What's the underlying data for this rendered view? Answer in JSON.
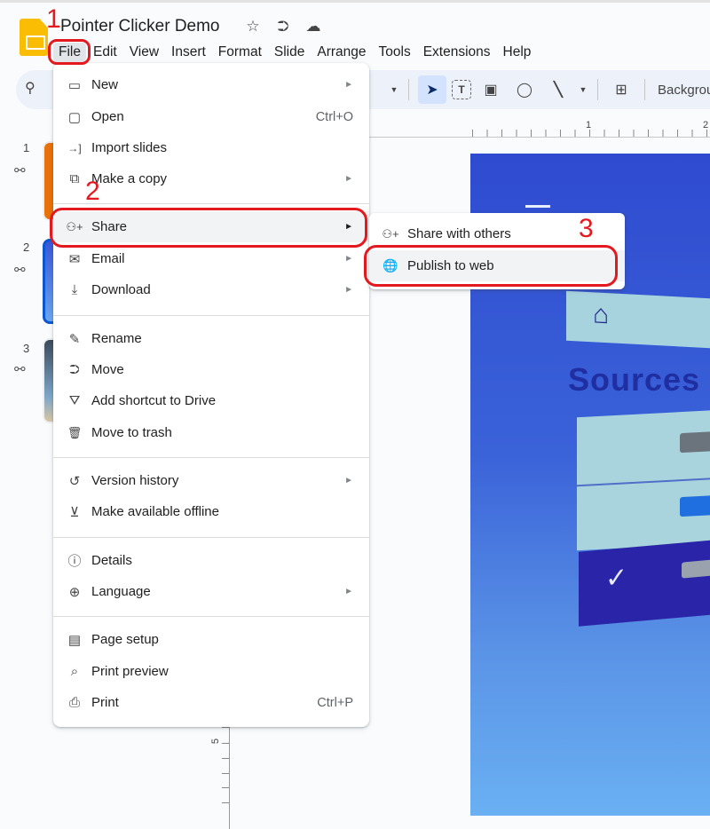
{
  "app": {
    "title": "Pointer Clicker Demo",
    "title_icons": [
      {
        "name": "star-icon",
        "glyph": "☆"
      },
      {
        "name": "move-to-folder-icon",
        "glyph": "⮊"
      },
      {
        "name": "cloud-saved-icon",
        "glyph": "☁"
      }
    ],
    "brand_color": "#fbbc04"
  },
  "menubar": {
    "items": [
      "File",
      "Edit",
      "View",
      "Insert",
      "Format",
      "Slide",
      "Arrange",
      "Tools",
      "Extensions",
      "Help"
    ],
    "active": "File"
  },
  "toolbar": {
    "search_icon": "⚲",
    "tools": [
      {
        "name": "select-icon",
        "glyph": "➤",
        "selected": true
      },
      {
        "name": "text-box-icon",
        "glyph": "T"
      },
      {
        "name": "image-icon",
        "glyph": "▣"
      },
      {
        "name": "shape-icon",
        "glyph": "◯"
      },
      {
        "name": "line-icon",
        "glyph": "╲"
      }
    ],
    "comment_icon": "⊞",
    "background_label": "Backgrour"
  },
  "ruler": {
    "h_labels": [
      "1",
      "2"
    ],
    "v_labels": [
      "5"
    ]
  },
  "filmstrip": {
    "slides": [
      {
        "number": "1",
        "link_icon": "⚯"
      },
      {
        "number": "2",
        "link_icon": "⚯",
        "selected": true
      },
      {
        "number": "3",
        "link_icon": "⚯"
      }
    ]
  },
  "slide_content": {
    "heading": "Sources",
    "check_glyph": "✓",
    "home_glyph": "⌂"
  },
  "file_menu": {
    "groups": [
      [
        {
          "label": "New",
          "icon": "new-slides-icon",
          "glyph": "▭",
          "submenu": true
        },
        {
          "label": "Open",
          "icon": "folder-icon",
          "glyph": "▢",
          "shortcut": "Ctrl+O"
        },
        {
          "label": "Import slides",
          "icon": "import-icon",
          "glyph": "→]"
        },
        {
          "label": "Make a copy",
          "icon": "copy-icon",
          "glyph": "⧉",
          "submenu": true
        }
      ],
      [
        {
          "label": "Share",
          "icon": "person-add-icon",
          "glyph": "⚇+",
          "submenu": true,
          "highlighted": true
        },
        {
          "label": "Email",
          "icon": "email-icon",
          "glyph": "✉",
          "submenu": true
        },
        {
          "label": "Download",
          "icon": "download-icon",
          "glyph": "⤓",
          "submenu": true
        }
      ],
      [
        {
          "label": "Rename",
          "icon": "rename-icon",
          "glyph": "✎"
        },
        {
          "label": "Move",
          "icon": "move-folder-icon",
          "glyph": "⮊"
        },
        {
          "label": "Add shortcut to Drive",
          "icon": "drive-shortcut-icon",
          "glyph": "⛛"
        },
        {
          "label": "Move to trash",
          "icon": "trash-icon",
          "glyph": "🗑"
        }
      ],
      [
        {
          "label": "Version history",
          "icon": "history-icon",
          "glyph": "↺",
          "submenu": true
        },
        {
          "label": "Make available offline",
          "icon": "offline-icon",
          "glyph": "⊻"
        }
      ],
      [
        {
          "label": "Details",
          "icon": "info-icon",
          "glyph": "ⓘ"
        },
        {
          "label": "Language",
          "icon": "globe-icon",
          "glyph": "⊕",
          "submenu": true
        }
      ],
      [
        {
          "label": "Page setup",
          "icon": "page-setup-icon",
          "glyph": "▤"
        },
        {
          "label": "Print preview",
          "icon": "print-preview-icon",
          "glyph": "⌕"
        },
        {
          "label": "Print",
          "icon": "print-icon",
          "glyph": "⎙",
          "shortcut": "Ctrl+P"
        }
      ]
    ],
    "submenu_arrow": "►"
  },
  "share_submenu": {
    "items": [
      {
        "label": "Share with others",
        "icon": "person-add-icon",
        "glyph": "⚇+"
      },
      {
        "label": "Publish to web",
        "icon": "public-globe-icon",
        "glyph": "🌐",
        "highlighted": true
      }
    ]
  },
  "annotations": {
    "color": "#e3191f",
    "steps": [
      "1",
      "2",
      "3"
    ]
  }
}
